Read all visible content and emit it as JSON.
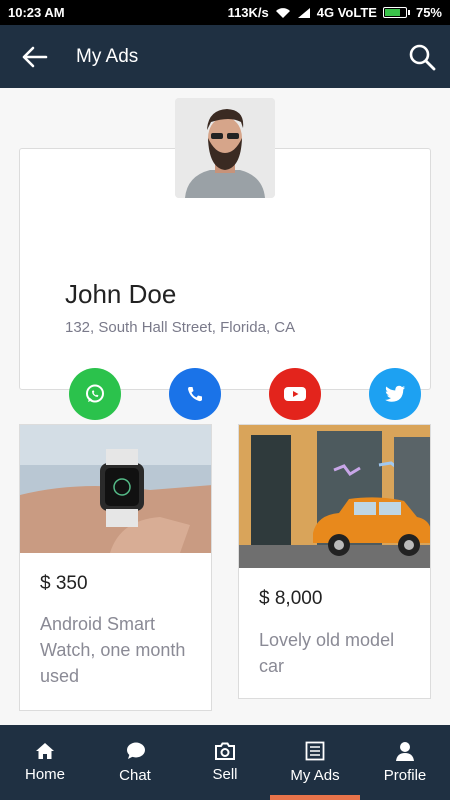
{
  "status_bar": {
    "time": "10:23 AM",
    "speed": "113K/s",
    "network": "4G VoLTE",
    "battery": "75%"
  },
  "app_bar": {
    "title": "My Ads"
  },
  "profile": {
    "name": "John Doe",
    "address": "132, South Hall Street, Florida, CA",
    "socials": [
      {
        "icon": "whatsapp-icon",
        "color": "#2bc24c"
      },
      {
        "icon": "phone-icon",
        "color": "#1a73e8"
      },
      {
        "icon": "youtube-icon",
        "color": "#e3241c"
      },
      {
        "icon": "twitter-icon",
        "color": "#1da1f2"
      }
    ]
  },
  "ads": [
    {
      "price": "$ 350",
      "description": "Android Smart Watch, one month used"
    },
    {
      "price": "$ 8,000",
      "description": "Lovely old model car"
    }
  ],
  "bottom_nav": {
    "items": [
      {
        "label": "Home",
        "icon": "home-icon"
      },
      {
        "label": "Chat",
        "icon": "chat-icon"
      },
      {
        "label": "Sell",
        "icon": "camera-icon"
      },
      {
        "label": "My Ads",
        "icon": "list-icon",
        "active": true
      },
      {
        "label": "Profile",
        "icon": "user-icon"
      }
    ]
  },
  "colors": {
    "primary": "#1f3042",
    "accent": "#e8734a"
  }
}
